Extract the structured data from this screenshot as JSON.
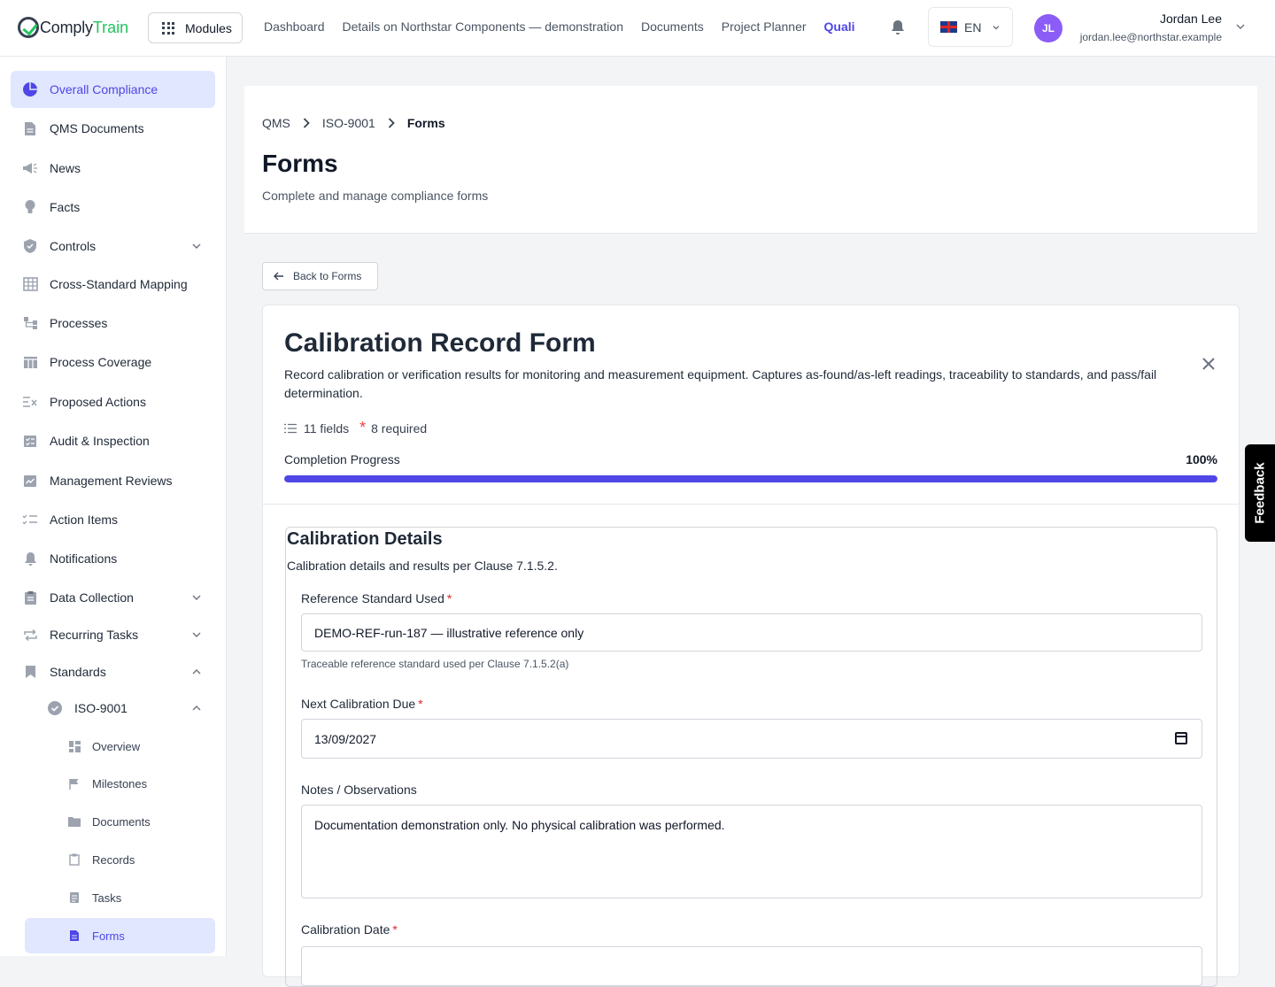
{
  "app": {
    "logo_part1": "Comply",
    "logo_part2": "Train",
    "modules_label": "Modules"
  },
  "topnav": {
    "items": [
      "Dashboard",
      "Details on Northstar Components — demonstration",
      "Documents",
      "Project Planner"
    ],
    "active": "Quali"
  },
  "language": {
    "label": "EN"
  },
  "user": {
    "initials": "JL",
    "name": "Jordan Lee",
    "email": "jordan.lee@northstar.example"
  },
  "sidebar": {
    "items": [
      {
        "label": "Overall Compliance",
        "icon": "pie-chart-icon"
      },
      {
        "label": "QMS Documents",
        "icon": "document-icon"
      },
      {
        "label": "News",
        "icon": "megaphone-icon"
      },
      {
        "label": "Facts",
        "icon": "lightbulb-icon"
      },
      {
        "label": "Controls",
        "icon": "shield-icon"
      },
      {
        "label": "Cross-Standard Mapping",
        "icon": "table-icon"
      },
      {
        "label": "Processes",
        "icon": "flow-icon"
      },
      {
        "label": "Process Coverage",
        "icon": "columns-icon"
      },
      {
        "label": "Proposed Actions",
        "icon": "list-x-icon"
      },
      {
        "label": "Audit & Inspection",
        "icon": "checklist-icon"
      },
      {
        "label": "Management Reviews",
        "icon": "chart-icon"
      },
      {
        "label": "Action Items",
        "icon": "checklist-lines-icon"
      },
      {
        "label": "Notifications",
        "icon": "bell-icon"
      },
      {
        "label": "Data Collection",
        "icon": "clipboard-icon"
      },
      {
        "label": "Recurring Tasks",
        "icon": "repeat-icon"
      },
      {
        "label": "Standards",
        "icon": "bookmark-icon"
      }
    ],
    "standard": {
      "label": "ISO-9001",
      "icon": "badge-check-icon"
    },
    "subitems": [
      {
        "label": "Overview",
        "icon": "dashboard-icon"
      },
      {
        "label": "Milestones",
        "icon": "flag-icon"
      },
      {
        "label": "Documents",
        "icon": "folder-icon"
      },
      {
        "label": "Records",
        "icon": "clipboard-icon"
      },
      {
        "label": "Tasks",
        "icon": "task-icon"
      },
      {
        "label": "Forms",
        "icon": "form-icon"
      }
    ]
  },
  "header": {
    "breadcrumb": [
      "QMS",
      "ISO-9001",
      "Forms"
    ],
    "title": "Forms",
    "subtitle": "Complete and manage compliance forms"
  },
  "back_label": "Back to Forms",
  "form": {
    "title": "Calibration Record Form",
    "description": "Record calibration or verification results for monitoring and measurement equipment. Captures as-found/as-left readings, traceability to standards, and pass/fail determination.",
    "fields_count": "11 fields",
    "required_count": "8 required",
    "progress_label": "Completion Progress",
    "progress_pct": "100%",
    "progress_value": 1.0,
    "section": {
      "title": "Calibration Details",
      "description": "Calibration details and results per Clause 7.1.5.2."
    },
    "fields": [
      {
        "label": "Reference Standard Used",
        "required": true,
        "value": "DEMO-REF-run-187 — illustrative reference only",
        "help": "Traceable reference standard used per Clause 7.1.5.2(a)"
      },
      {
        "label": "Next Calibration Due",
        "required": true,
        "value": "13/09/2027"
      },
      {
        "label": "Notes / Observations",
        "required": false,
        "value": "Documentation demonstration only. No physical calibration was performed."
      },
      {
        "label": "Calibration Date",
        "required": true,
        "value": ""
      }
    ]
  },
  "feedback_label": "Feedback",
  "colors": {
    "accent": "#4f46e5",
    "required": "#dc2626",
    "brand_green": "#22c55e"
  }
}
